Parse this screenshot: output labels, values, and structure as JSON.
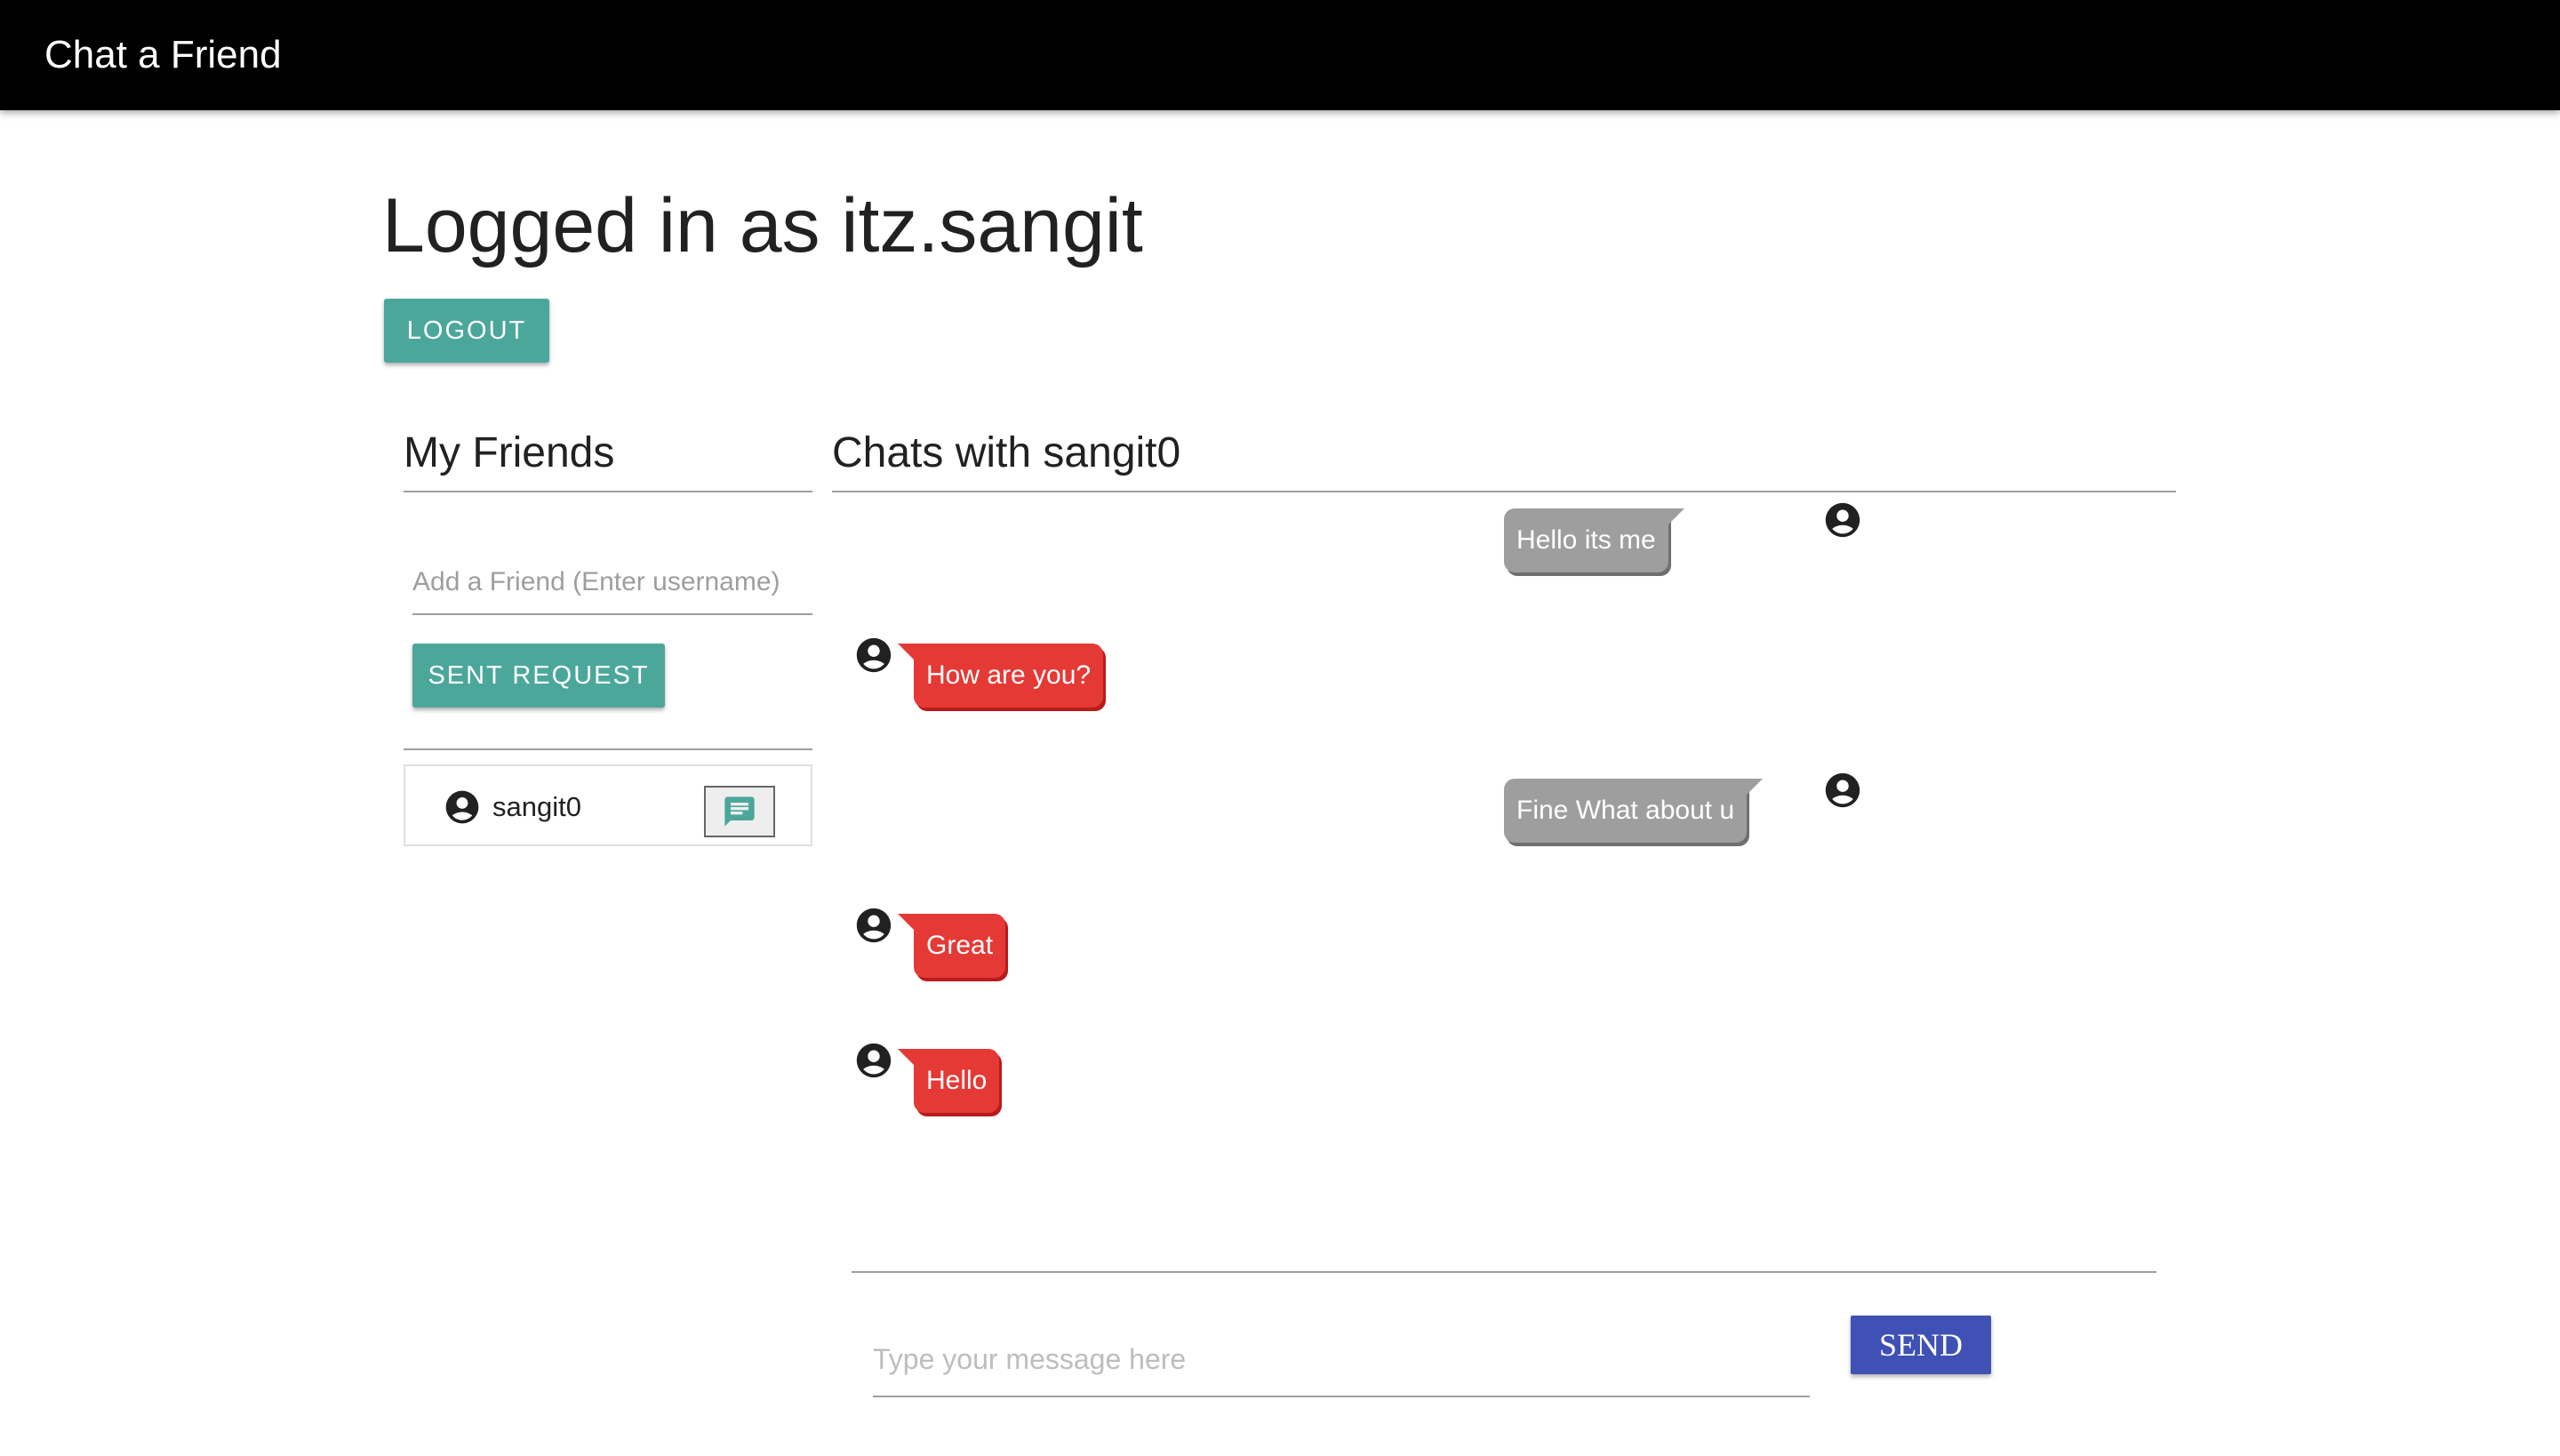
{
  "app": {
    "title": "Chat a Friend"
  },
  "header": {
    "logged_in_text": "Logged in as itz.sangit",
    "logout_label": "LOGOUT"
  },
  "friends_panel": {
    "heading": "My Friends",
    "add_friend_placeholder": "Add a Friend (Enter username)",
    "add_friend_value": "",
    "sent_request_label": "SENT REQUEST",
    "friends": [
      {
        "name": "sangit0",
        "avatar_icon": "account-circle-icon",
        "action_icon": "chat-icon"
      }
    ]
  },
  "chat_panel": {
    "heading": "Chats with sangit0",
    "messages": [
      {
        "sender": "me",
        "text": "Hello its me"
      },
      {
        "sender": "friend",
        "text": "How are you?"
      },
      {
        "sender": "me",
        "text": "Fine What about u"
      },
      {
        "sender": "friend",
        "text": "Great"
      },
      {
        "sender": "friend",
        "text": "Hello"
      }
    ],
    "message_placeholder": "Type your message here",
    "message_value": "",
    "send_label": "SEND"
  },
  "colors": {
    "topbar": "#000000",
    "teal_button": "#4ca79b",
    "send_button": "#3f51b5",
    "my_bubble": "#9e9e9e",
    "friend_bubble": "#e53935"
  }
}
